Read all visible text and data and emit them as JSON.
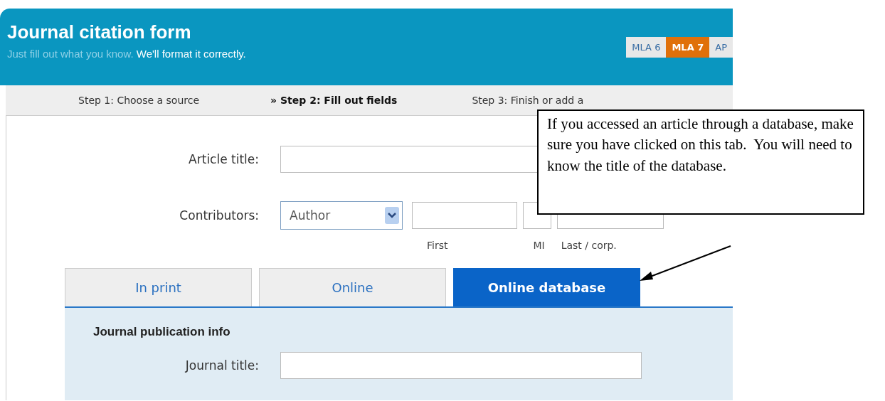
{
  "header": {
    "title": "Journal citation form",
    "subtitle_muted": "Just fill out what you know.",
    "subtitle": "We'll format it correctly."
  },
  "styles": [
    {
      "label": "MLA 6",
      "selected": false
    },
    {
      "label": "MLA 7",
      "selected": true
    },
    {
      "label": "AP",
      "selected": false
    }
  ],
  "steps": [
    {
      "label": "Step 1: Choose a source",
      "current": false
    },
    {
      "label": "» Step 2: Fill out fields",
      "current": true
    },
    {
      "label": "Step 3: Finish or add a",
      "current": false
    }
  ],
  "article_title": {
    "label": "Article title:"
  },
  "contributors": {
    "label": "Contributors:",
    "role": "Author",
    "first": "First",
    "mi": "MI",
    "last": "Last / corp."
  },
  "tabs": [
    {
      "label": "In print",
      "selected": false
    },
    {
      "label": "Online",
      "selected": false
    },
    {
      "label": "Online database",
      "selected": true
    }
  ],
  "publication": {
    "heading": "Journal publication info",
    "journal_title_label": "Journal title:"
  },
  "callout": {
    "text": "If you accessed an article through a database, make sure you have clicked on this tab.  You will need to know the title of the database."
  }
}
